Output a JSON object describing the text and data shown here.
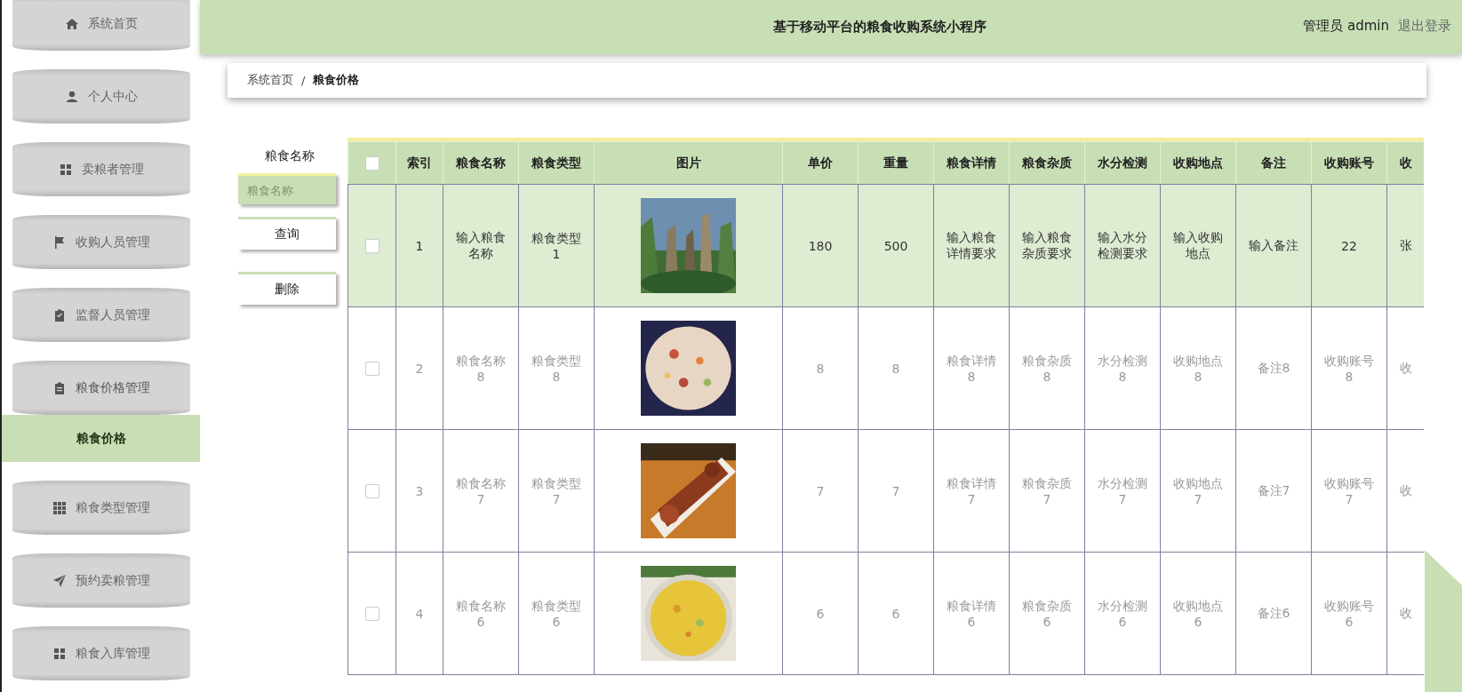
{
  "sidebar": {
    "items": [
      {
        "label": "系统首页"
      },
      {
        "label": "个人中心"
      },
      {
        "label": "卖粮者管理"
      },
      {
        "label": "收购人员管理"
      },
      {
        "label": "监督人员管理"
      },
      {
        "label": "粮食价格管理",
        "expanded": true,
        "children": [
          {
            "label": "粮食价格",
            "selected": true
          }
        ]
      },
      {
        "label": "粮食类型管理"
      },
      {
        "label": "预约卖粮管理"
      },
      {
        "label": "粮食入库管理"
      }
    ]
  },
  "header": {
    "title": "基于移动平台的粮食收购系统小程序",
    "user": "管理员 admin",
    "logout": "退出登录"
  },
  "breadcrumb": {
    "items": [
      "系统首页",
      "粮食价格"
    ],
    "separator": "/"
  },
  "search": {
    "label": "粮食名称",
    "placeholder": "粮食名称",
    "buttons": [
      "查询",
      "删除"
    ]
  },
  "table": {
    "select_all": {
      "checked": false
    },
    "columns": [
      {
        "kind": "text",
        "label": "索引"
      },
      {
        "kind": "text",
        "label": "粮食名称"
      },
      {
        "kind": "text",
        "label": "粮食类型"
      },
      {
        "kind": "picture",
        "label": "图片"
      },
      {
        "kind": "text",
        "label": "单价"
      },
      {
        "kind": "text",
        "label": "重量"
      },
      {
        "kind": "text",
        "label": "粮食详情"
      },
      {
        "kind": "text",
        "label": "粮食杂质"
      },
      {
        "kind": "text",
        "label": "水分检测"
      },
      {
        "kind": "text",
        "label": "收购地点"
      },
      {
        "kind": "text",
        "label": "备注"
      },
      {
        "kind": "text",
        "label": "收购账号"
      },
      {
        "kind": "text",
        "label": "收"
      }
    ],
    "rows": [
      {
        "selected": true,
        "checked": false,
        "cells": [
          "1",
          "输入粮食名称",
          "粮食类型1",
          {
            "kind": "picture"
          },
          "180",
          "500",
          "输入粮食详情要求",
          "输入粮食杂质要求",
          "输入水分检测要求",
          "输入收购地点",
          "输入备注",
          "22",
          "张"
        ]
      },
      {
        "selected": false,
        "checked": false,
        "cells": [
          "2",
          "粮食名称8",
          "粮食类型8",
          {
            "kind": "picture"
          },
          "8",
          "8",
          "粮食详情8",
          "粮食杂质8",
          "水分检测8",
          "收购地点8",
          "备注8",
          "收购账号8",
          "收"
        ]
      },
      {
        "selected": false,
        "checked": false,
        "cells": [
          "3",
          "粮食名称7",
          "粮食类型7",
          {
            "kind": "picture"
          },
          "7",
          "7",
          "粮食详情7",
          "粮食杂质7",
          "水分检测7",
          "收购地点7",
          "备注7",
          "收购账号7",
          "收"
        ]
      },
      {
        "selected": false,
        "checked": false,
        "cells": [
          "4",
          "粮食名称6",
          "粮食类型6",
          {
            "kind": "picture"
          },
          "6",
          "6",
          "粮食详情6",
          "粮食杂质6",
          "水分检测6",
          "收购地点6",
          "备注6",
          "收购账号6",
          "收"
        ]
      }
    ]
  }
}
